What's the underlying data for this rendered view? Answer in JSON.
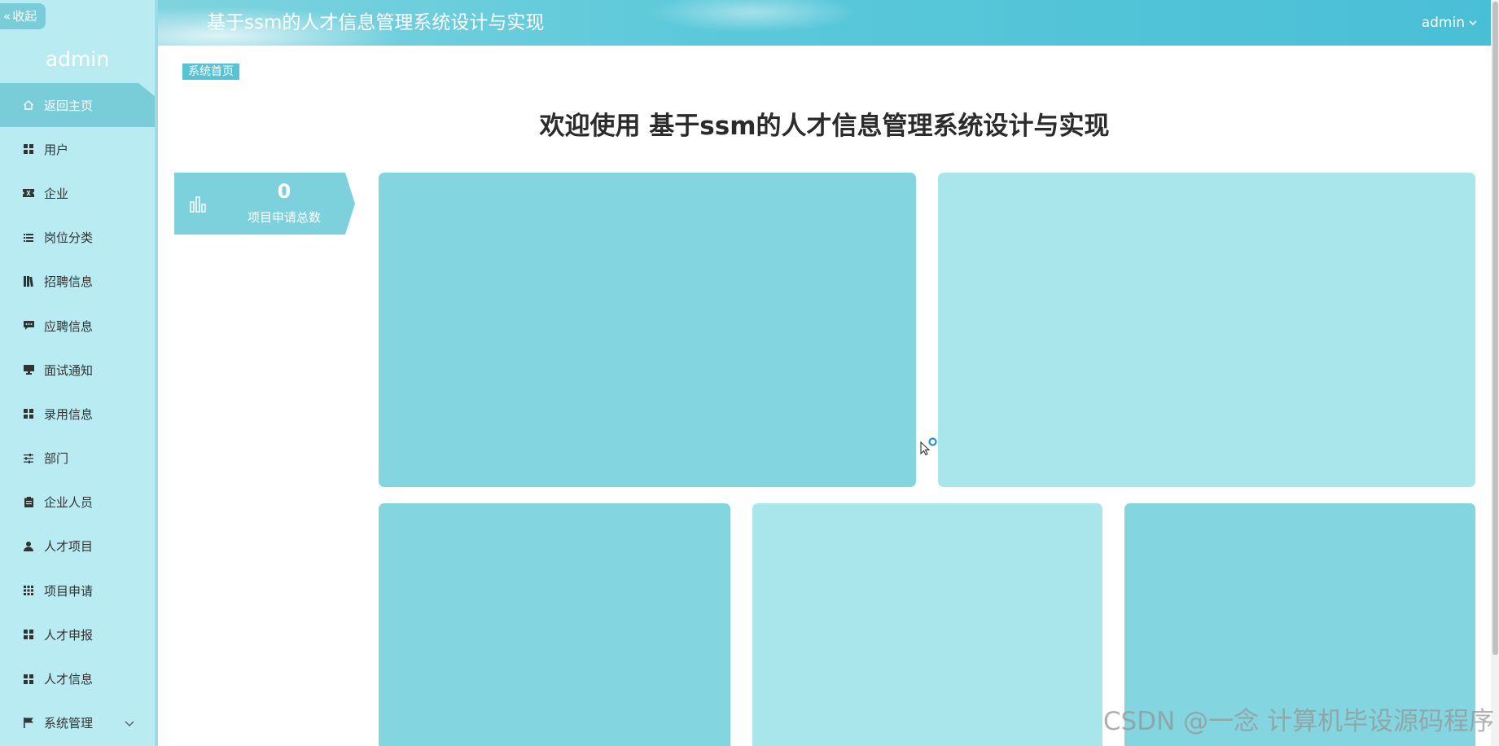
{
  "sidebar": {
    "collapse_label": "收起",
    "user": "admin",
    "items": [
      {
        "label": "返回主页",
        "icon": "home-icon"
      },
      {
        "label": "用户",
        "icon": "grid-icon"
      },
      {
        "label": "企业",
        "icon": "ticket-icon"
      },
      {
        "label": "岗位分类",
        "icon": "list-icon"
      },
      {
        "label": "招聘信息",
        "icon": "book-icon"
      },
      {
        "label": "应聘信息",
        "icon": "chat-icon"
      },
      {
        "label": "面试通知",
        "icon": "monitor-icon"
      },
      {
        "label": "录用信息",
        "icon": "grid-icon"
      },
      {
        "label": "部门",
        "icon": "sliders-icon"
      },
      {
        "label": "企业人员",
        "icon": "clipboard-icon"
      },
      {
        "label": "人才项目",
        "icon": "person-icon"
      },
      {
        "label": "项目申请",
        "icon": "apps-icon"
      },
      {
        "label": "人才申报",
        "icon": "grid-icon"
      },
      {
        "label": "人才信息",
        "icon": "grid-icon"
      },
      {
        "label": "系统管理",
        "icon": "flag-icon"
      }
    ],
    "active_index": 0
  },
  "header": {
    "title": "基于ssm的人才信息管理系统设计与实现",
    "user": "admin"
  },
  "breadcrumb": "系统首页",
  "welcome": "欢迎使用 基于ssm的人才信息管理系统设计与实现",
  "stat": {
    "value": "0",
    "label": "项目申请总数",
    "icon": "bar-chart-icon"
  },
  "watermark": "CSDN @一念 计算机毕设源码程序",
  "colors": {
    "accent": "#78cdd9",
    "sidebar_bg": "#b8ebf2",
    "panel_dark": "#83d5df",
    "panel_light": "#a8e6ec"
  }
}
